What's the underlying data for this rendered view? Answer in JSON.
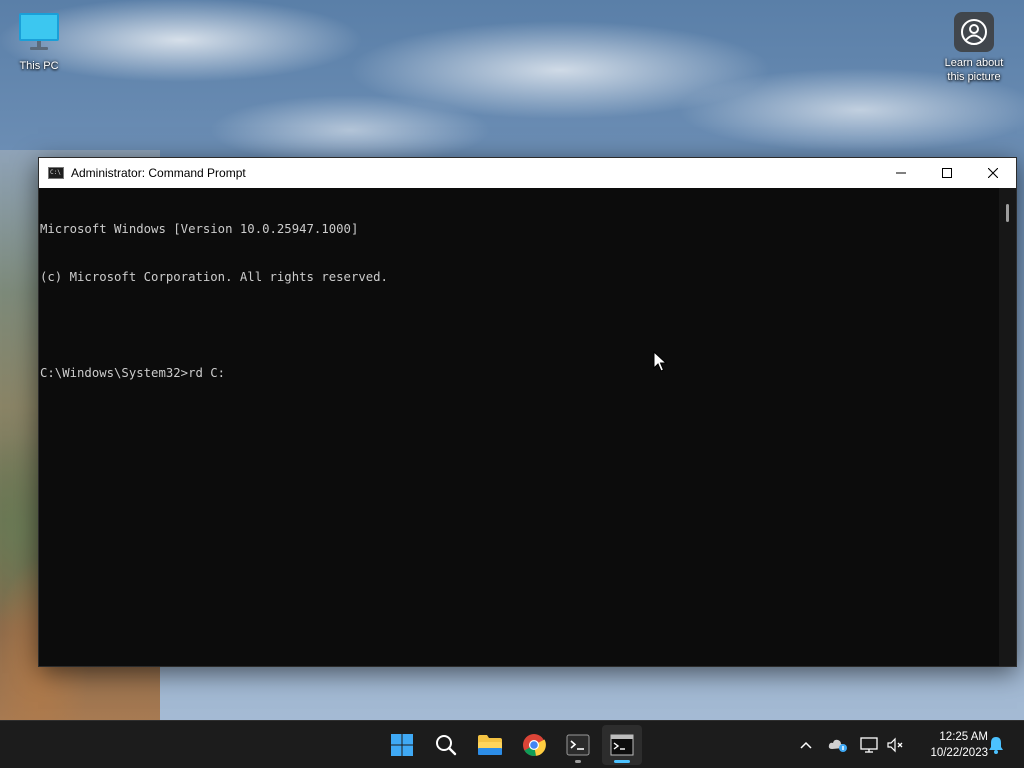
{
  "desktop": {
    "icons": [
      {
        "label": "This PC"
      },
      {
        "label": "Learn about this picture"
      }
    ]
  },
  "window": {
    "title": "Administrator: Command Prompt",
    "app_icon_text": "C:\\",
    "console_lines": [
      "Microsoft Windows [Version 10.0.25947.1000]",
      "(c) Microsoft Corporation. All rights reserved.",
      "",
      "C:\\Windows\\System32>rd C:"
    ]
  },
  "taskbar": {
    "apps": [
      "start",
      "search",
      "file-explorer",
      "chrome",
      "terminal",
      "command-prompt"
    ],
    "clock": {
      "time": "12:25 AM",
      "date": "10/22/2023"
    }
  },
  "colors": {
    "console_bg": "#0c0c0c",
    "console_fg": "#cccccc",
    "taskbar_bg": "#1c1c1c",
    "accent": "#4cc2ff"
  }
}
